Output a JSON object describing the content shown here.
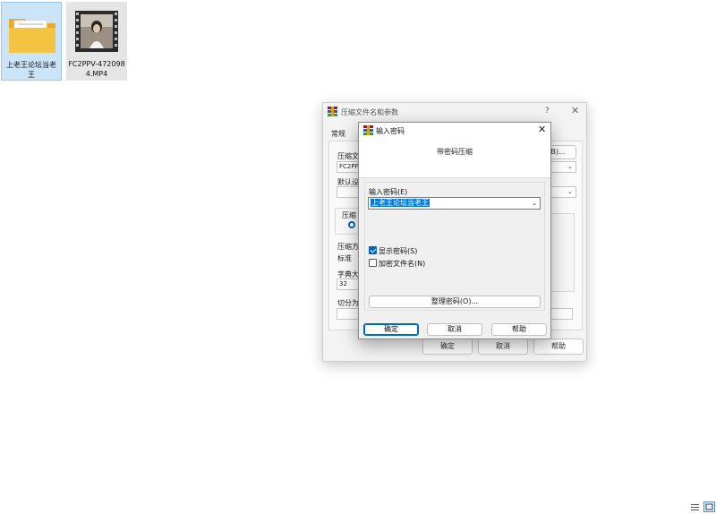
{
  "desktop": {
    "files": [
      {
        "name": "上老王论坛当老王",
        "type": "folder"
      },
      {
        "name": "FC2PPV-4720984.MP4",
        "type": "video"
      }
    ]
  },
  "back_dialog": {
    "title": "压缩文件名和参数",
    "help_glyph": "?",
    "close_glyph": "✕",
    "tab_general": "常规",
    "archive_name_label": "压缩文",
    "archive_name_value": "FC2PPV",
    "browse_button_label": "(B)...",
    "default_profile_label": "默认设",
    "archive_format_label": "压缩",
    "method_label": "压缩方",
    "method_value": "标准",
    "dict_label": "字典大",
    "dict_value": "32",
    "split_label": "切分为",
    "ok_label": "确定",
    "cancel_label": "取消",
    "help_label": "帮助"
  },
  "front_dialog": {
    "title": "输入密码",
    "close_glyph": "✕",
    "header_text": "带密码压缩",
    "password_label": "输入密码(E)",
    "password_value": "上老王论坛当老王",
    "show_password_label": "显示密码(S)",
    "show_password_checked": true,
    "encrypt_names_label": "加密文件名(N)",
    "encrypt_names_checked": false,
    "organize_button_label": "整理密码(O)...",
    "ok_label": "确定",
    "cancel_label": "取消",
    "help_label": "帮助"
  },
  "icons": {
    "app_icon": "winrar-icon",
    "view_list": "list-view-icon",
    "view_tiles": "tile-view-icon"
  },
  "colors": {
    "accent": "#0067c0",
    "selection": "#0078d7",
    "folder": "#f5c342"
  }
}
